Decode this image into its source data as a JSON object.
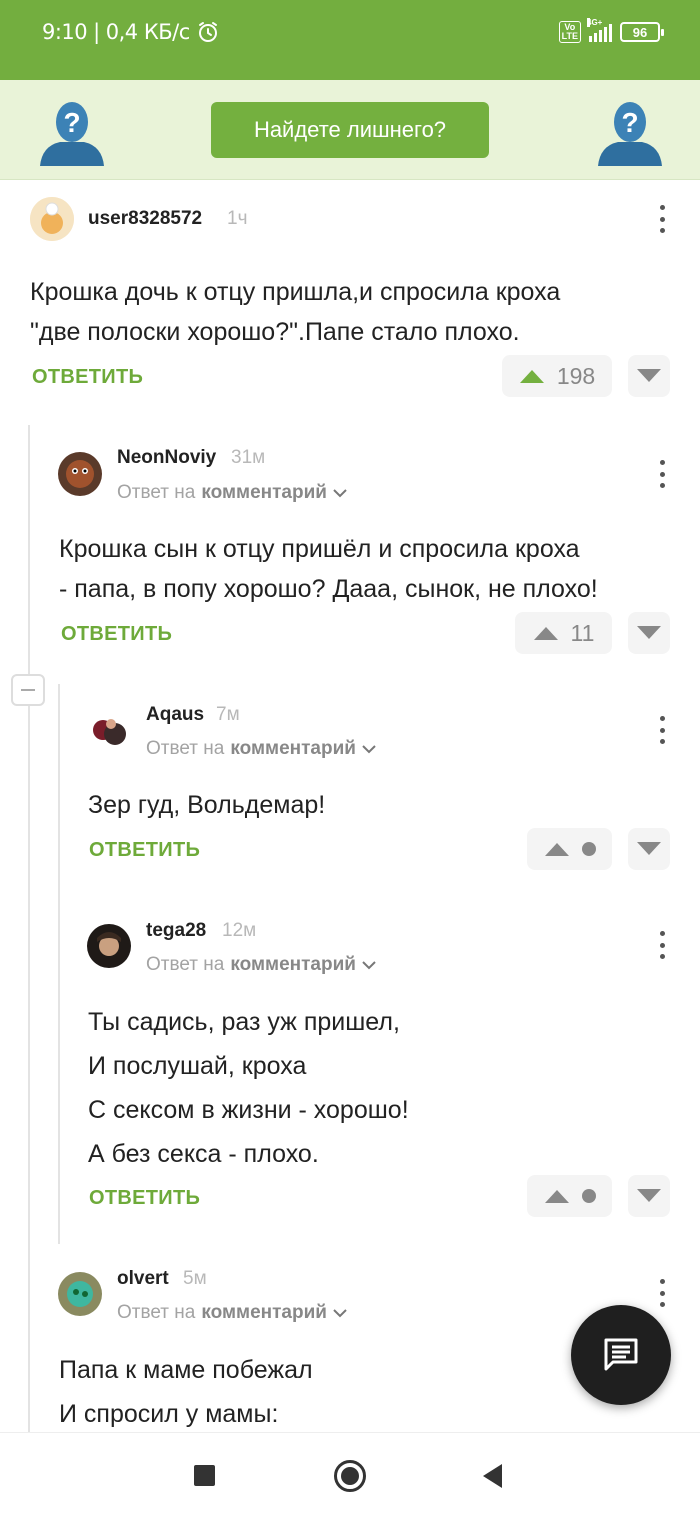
{
  "status_bar": {
    "time": "9:10",
    "separator": "|",
    "speed": "0,4 КБ/с",
    "volte_line1": "Vo",
    "volte_line2": "LTE",
    "network": "4G+",
    "battery": "96"
  },
  "banner": {
    "button_label": "Найдете лишнего?"
  },
  "comments": [
    {
      "username": "user8328572",
      "time": "1ч",
      "text": "Крошка дочь к отцу пришла,и спросила кроха\n\"две полоски хорошо?\".Папе стало плохо.",
      "reply_label": "ОТВЕТИТЬ",
      "rating": "198"
    },
    {
      "username": "NeonNoviy",
      "time": "31м",
      "reply_prefix": "Ответ на",
      "reply_target": "комментарий",
      "text": "Крошка сын к отцу пришёл и спросила кроха\n- папа, в попу хорошо? Дааа, сынок, не плохо!",
      "reply_label": "ОТВЕТИТЬ",
      "rating": "11"
    },
    {
      "username": "Aqaus",
      "time": "7м",
      "reply_prefix": "Ответ на",
      "reply_target": "комментарий",
      "text": "Зер гуд, Вольдемар!",
      "reply_label": "ОТВЕТИТЬ"
    },
    {
      "username": "tega28",
      "time": "12м",
      "reply_prefix": "Ответ на",
      "reply_target": "комментарий",
      "text_lines": [
        "Ты садись, раз уж пришел,",
        "И послушай, кроха",
        "С сексом в жизни - хорошо!",
        "А без секса - плохо."
      ],
      "reply_label": "ОТВЕТИТЬ"
    },
    {
      "username": "olvert",
      "time": "5м",
      "reply_prefix": "Ответ на",
      "reply_target": "комментарий",
      "text_lines": [
        "Папа к маме побежал",
        "И спросил у мамы:"
      ]
    }
  ],
  "icons": {
    "alarm": "alarm-clock-icon",
    "vote_up": "arrow-up-icon",
    "vote_down": "arrow-down-icon",
    "more": "more-vertical-icon",
    "fab": "message-icon",
    "nav_recents": "square-icon",
    "nav_home": "circle-icon",
    "nav_back": "triangle-back-icon"
  },
  "colors": {
    "brand_green": "#73ae3f",
    "banner_bg": "#e9f3d8",
    "reply_green": "#6eaa3a"
  }
}
